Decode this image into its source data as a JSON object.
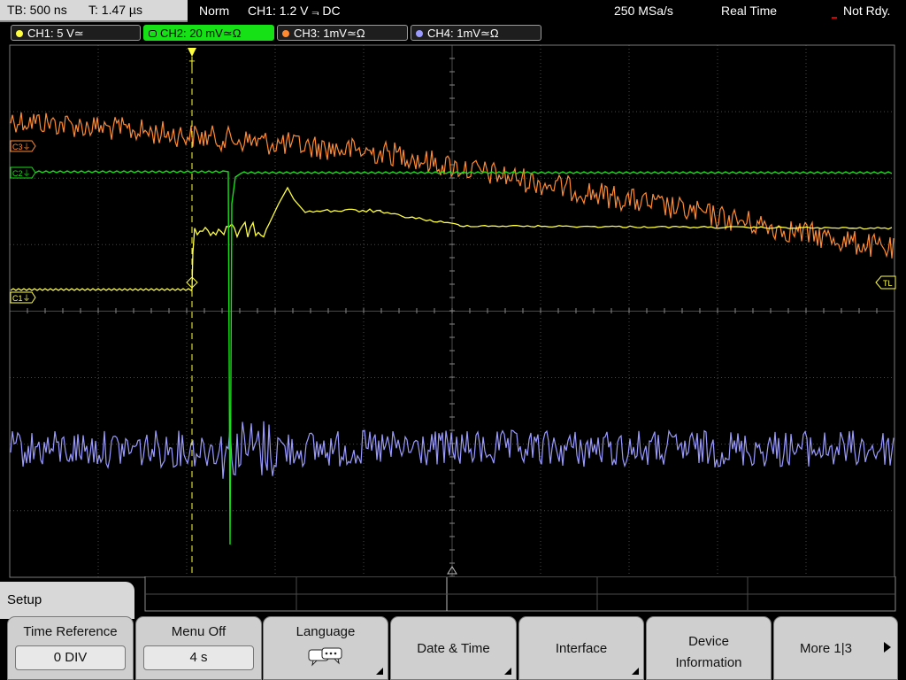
{
  "status": {
    "timebase": "TB: 500 ns",
    "trig_time": "T: 1.47 µs",
    "mode": "Norm",
    "trigger": "CH1: 1.2 V ⫬ DC",
    "samplerate": "250 MSa/s",
    "acq_mode": "Real Time",
    "state": "Not Rdy."
  },
  "channels": [
    {
      "label": "CH1: 5 V≃",
      "color": "#ffff40"
    },
    {
      "label": "CH2: 20 mV≃Ω",
      "color": "#16e016"
    },
    {
      "label": "CH3: 1mV≃Ω",
      "color": "#ff8a30"
    },
    {
      "label": "CH4: 1mV≃Ω",
      "color": "#9a9aff"
    }
  ],
  "markers": {
    "c3": "C3⏚",
    "c2": "C2⏚",
    "c1": "C1⏚",
    "tl": "TL",
    "trigger": "T"
  },
  "menu": {
    "title": "Setup",
    "softkeys": [
      {
        "label": "Time Reference",
        "value": "0 DIV"
      },
      {
        "label": "Menu Off",
        "value": "4 s"
      },
      {
        "label": "Language",
        "icon": "speech-bubble-icon"
      },
      {
        "label": "Date & Time"
      },
      {
        "label": "Interface"
      },
      {
        "label_line1": "Device",
        "label_line2": "Information"
      },
      {
        "label": "More 1|3"
      }
    ]
  },
  "colors": {
    "grid": "#4a4a4a",
    "ch1": "#ffff40",
    "ch2": "#16e016",
    "ch3": "#ff8a30",
    "ch4": "#9a9aff"
  }
}
